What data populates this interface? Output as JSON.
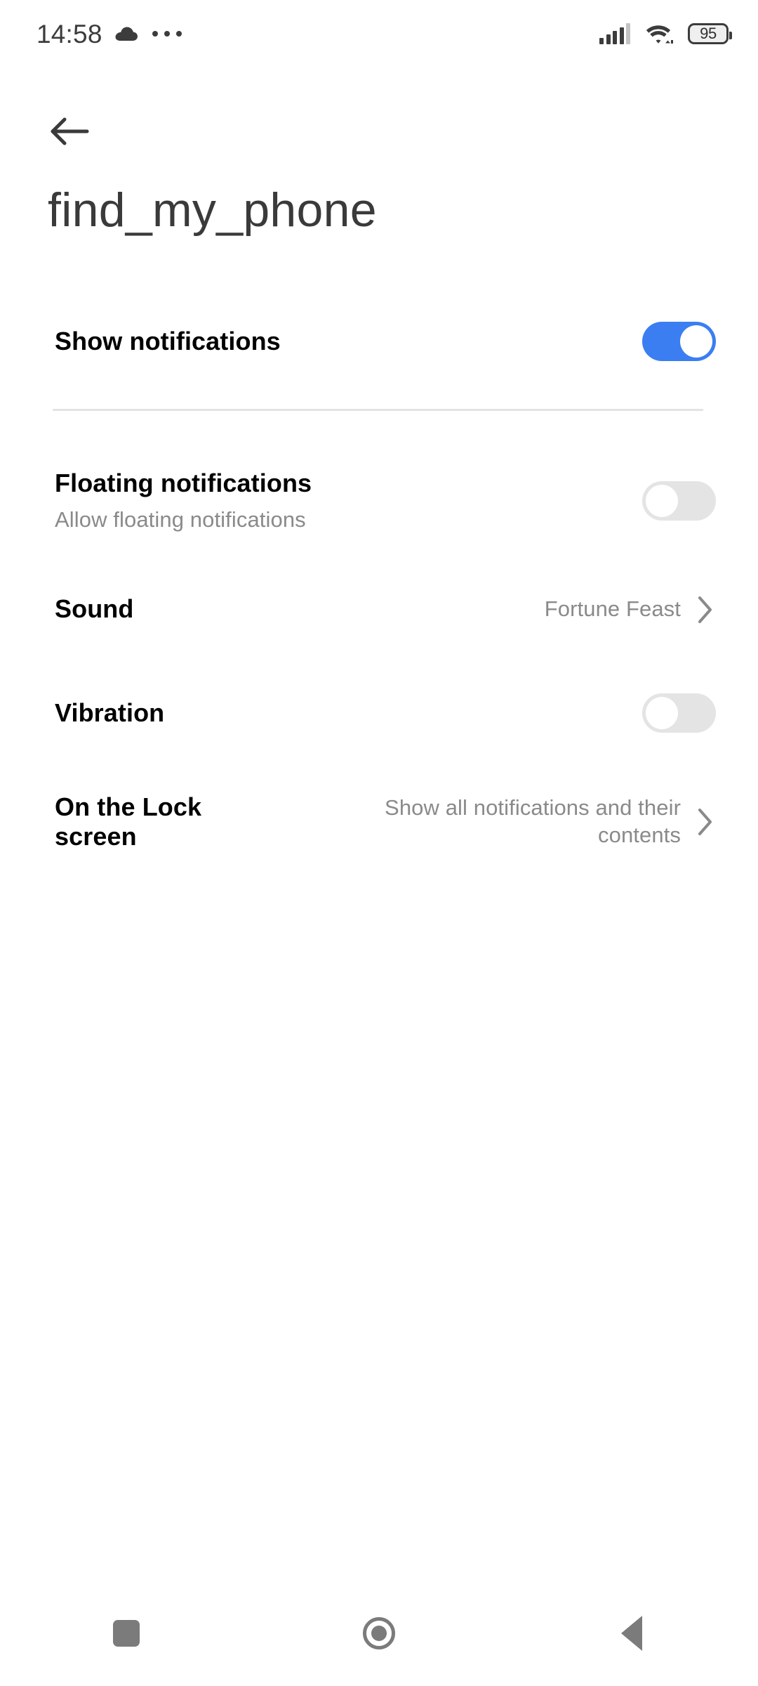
{
  "status_bar": {
    "time": "14:58",
    "cloud_icon": "cloud-icon",
    "overflow_icon": "more-dots-icon",
    "signal_icon": "cellular-signal-icon",
    "wifi_icon": "wifi-icon",
    "battery_level": "95"
  },
  "header": {
    "back_icon": "back-arrow-icon",
    "title": "find_my_phone"
  },
  "settings": {
    "show_notifications": {
      "label": "Show notifications",
      "toggle_state": "on"
    },
    "floating_notifications": {
      "label": "Floating notifications",
      "subtitle": "Allow floating notifications",
      "toggle_state": "off"
    },
    "sound": {
      "label": "Sound",
      "value": "Fortune Feast",
      "chevron_icon": "chevron-right-icon"
    },
    "vibration": {
      "label": "Vibration",
      "toggle_state": "off"
    },
    "lock_screen": {
      "label": "On the Lock screen",
      "value": "Show all notifications and their contents",
      "chevron_icon": "chevron-right-icon"
    }
  },
  "nav_bar": {
    "recents_icon": "recents-square-icon",
    "home_icon": "home-circle-icon",
    "back_icon": "back-triangle-icon"
  },
  "colors": {
    "accent": "#3b7ef2",
    "toggle_off_track": "#e4e4e4",
    "divider": "#e3e3e3",
    "secondary_text": "#8a8a8a",
    "nav_icon": "#7b7b7b"
  }
}
